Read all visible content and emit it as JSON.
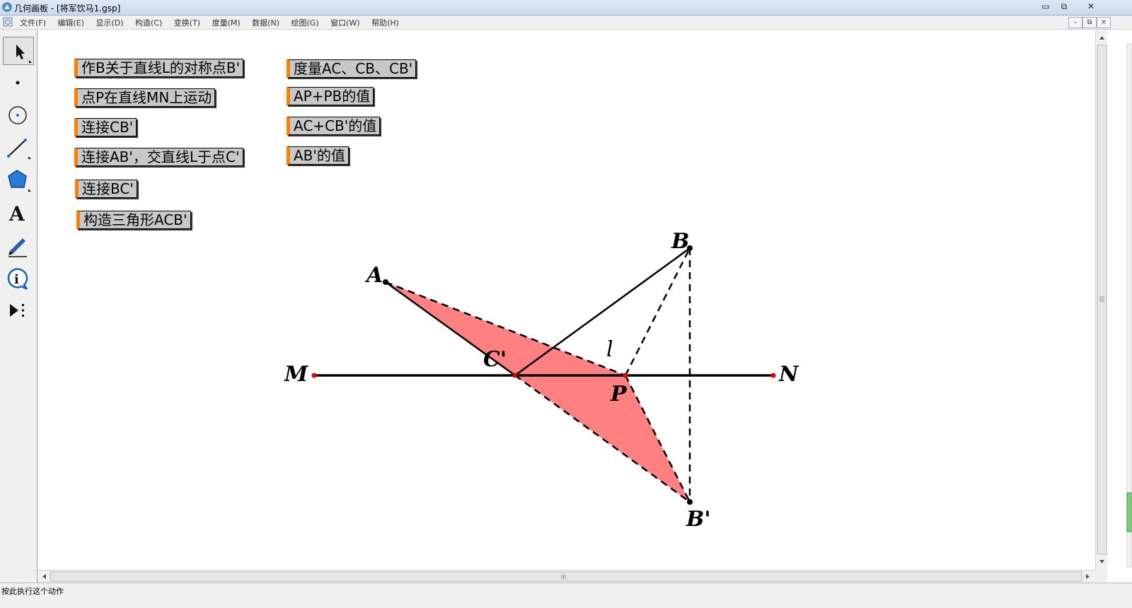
{
  "window": {
    "title": "几何画板 - [将军饮马1.gsp]",
    "minimize": "▭",
    "restore": "⧉",
    "close": "✕"
  },
  "menubar": {
    "items": [
      "文件(F)",
      "编辑(E)",
      "显示(D)",
      "构造(C)",
      "变换(T)",
      "度量(M)",
      "数据(N)",
      "绘图(G)",
      "窗口(W)",
      "帮助(H)"
    ],
    "mdi_minimize": "–",
    "mdi_restore": "⧉",
    "mdi_close": "×"
  },
  "toolbox": {
    "tools": [
      "arrow-select-icon",
      "point-icon",
      "compass-icon",
      "straightedge-icon",
      "polygon-icon",
      "text-icon",
      "marker-pen-icon",
      "information-icon",
      "custom-tool-icon"
    ],
    "text_tool_glyph": "A",
    "info_tool_glyph": "i",
    "selected_tool": "arrow-select-icon"
  },
  "action_buttons": {
    "reflect_b": "作B关于直线L的对称点B'",
    "point_p_moves": "点P在直线MN上运动",
    "connect_cb": "连接CB'",
    "connect_ab": "连接AB'，交直线L于点C'",
    "connect_bc": "连接BC'",
    "construct_triangle": "构造三角形ACB'",
    "measure": "度量AC、CB、CB'",
    "ap_pb_value": "AP+PB的值",
    "ac_cb_value": "AC+CB'的值",
    "ab_value": "AB'的值"
  },
  "geometry": {
    "label_A": "A",
    "label_B": "B",
    "label_M": "M",
    "label_N": "N",
    "label_P": "P",
    "label_C": "C'",
    "label_B_prime": "B'",
    "label_l": "l",
    "fill_color": "#ff8080",
    "line_color": "#000000",
    "point_color": "#e00000"
  },
  "scrollbars": {
    "h_thumb_grip": "III"
  },
  "status": {
    "text": "按此执行这个动作"
  },
  "colors": {
    "button_accent": "#ff8000",
    "button_face": "#c8c8c8",
    "chrome": "#f0f0f0"
  }
}
